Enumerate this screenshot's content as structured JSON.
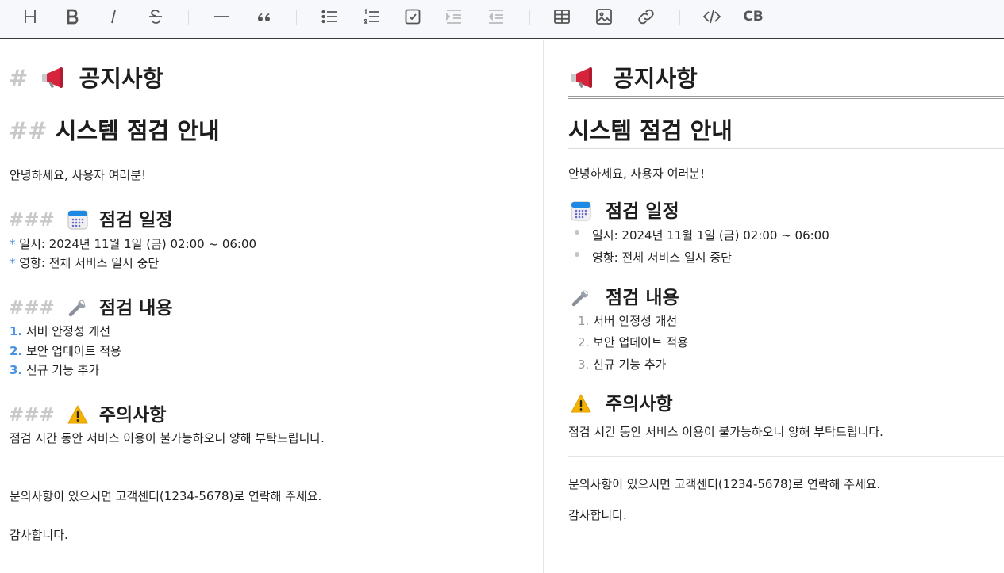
{
  "toolbar": {
    "buttons": [
      {
        "name": "heading-button",
        "icon": "heading-icon"
      },
      {
        "name": "bold-button",
        "icon": "bold-icon"
      },
      {
        "name": "italic-button",
        "icon": "italic-icon"
      },
      {
        "name": "strikethrough-button",
        "icon": "strikethrough-icon"
      },
      {
        "name": "horizontal-rule-button",
        "icon": "horizontal-rule-icon"
      },
      {
        "name": "blockquote-button",
        "icon": "quote-icon"
      },
      {
        "name": "bullet-list-button",
        "icon": "bullet-list-icon"
      },
      {
        "name": "numbered-list-button",
        "icon": "numbered-list-icon"
      },
      {
        "name": "task-list-button",
        "icon": "checkbox-icon"
      },
      {
        "name": "indent-button",
        "icon": "indent-icon"
      },
      {
        "name": "outdent-button",
        "icon": "outdent-icon"
      },
      {
        "name": "table-button",
        "icon": "table-icon"
      },
      {
        "name": "image-button",
        "icon": "image-icon"
      },
      {
        "name": "link-button",
        "icon": "link-icon"
      },
      {
        "name": "code-button",
        "icon": "code-icon"
      }
    ],
    "code_block_label": "CB"
  },
  "editor": {
    "h1_hash": "#",
    "h1_text": "공지사항",
    "h2_hash": "##",
    "h2_text": "시스템 점검 안내",
    "greeting": "안녕하세요, 사용자 여러분!",
    "h3_hash": "###",
    "schedule_title": "점검 일정",
    "bullet_marker": "*",
    "schedule_items": [
      "일시: 2024년 11월 1일 (금) 02:00 ~ 06:00",
      "영향: 전체 서비스 일시 중단"
    ],
    "content_title": "점검 내용",
    "content_markers": [
      "1.",
      "2.",
      "3."
    ],
    "content_items": [
      "서버 안정성 개선",
      "보안 업데이트 적용",
      "신규 기능 추가"
    ],
    "notice_title": "주의사항",
    "notice_text": "점검 시간 동안 서비스 이용이 불가능하오니 양해 부탁드립니다.",
    "hr_marker": "---",
    "contact_text": "문의사항이 있으시면 고객센터(1234-5678)로 연락해 주세요.",
    "thanks_text": "감사합니다."
  },
  "preview": {
    "h1_text": "공지사항",
    "h2_text": "시스템 점검 안내",
    "greeting": "안녕하세요, 사용자 여러분!",
    "schedule_title": "점검 일정",
    "schedule_items": [
      "일시: 2024년 11월 1일 (금) 02:00 ~ 06:00",
      "영향: 전체 서비스 일시 중단"
    ],
    "content_title": "점검 내용",
    "content_markers": [
      "1.",
      "2.",
      "3."
    ],
    "content_items": [
      "서버 안정성 개선",
      "보안 업데이트 적용",
      "신규 기능 추가"
    ],
    "notice_title": "주의사항",
    "notice_text": "점검 시간 동안 서비스 이용이 불가능하오니 양해 부탁드립니다.",
    "contact_text": "문의사항이 있으시면 고객센터(1234-5678)로 연락해 주세요.",
    "thanks_text": "감사합니다."
  },
  "icons": {
    "megaphone": "megaphone-icon",
    "calendar": "calendar-icon",
    "wrench": "wrench-icon",
    "warning": "warning-icon"
  },
  "colors": {
    "marker_blue": "#4a90e2",
    "hash_gray": "#c8c8c8",
    "megaphone_red": "#d6243c",
    "calendar_blue": "#1e88e5",
    "warning_yellow": "#f5b300"
  }
}
